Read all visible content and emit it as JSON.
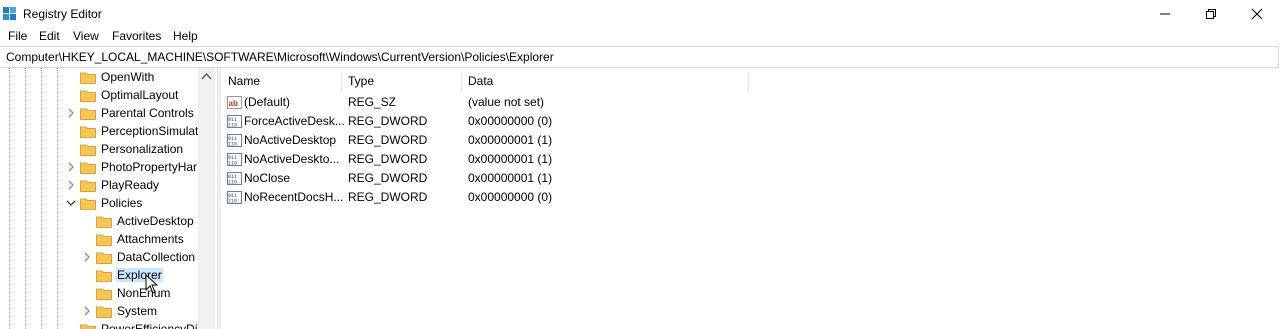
{
  "window": {
    "title": "Registry Editor"
  },
  "menu": [
    "File",
    "Edit",
    "View",
    "Favorites",
    "Help"
  ],
  "address": "Computer\\HKEY_LOCAL_MACHINE\\SOFTWARE\\Microsoft\\Windows\\CurrentVersion\\Policies\\Explorer",
  "tree": [
    {
      "label": "OpenWith",
      "expandable": false,
      "level": 0
    },
    {
      "label": "OptimalLayout",
      "expandable": false,
      "level": 0
    },
    {
      "label": "Parental Controls",
      "expandable": true,
      "level": 0
    },
    {
      "label": "PerceptionSimulat",
      "expandable": false,
      "level": 0
    },
    {
      "label": "Personalization",
      "expandable": false,
      "level": 0
    },
    {
      "label": "PhotoPropertyHar",
      "expandable": true,
      "level": 0
    },
    {
      "label": "PlayReady",
      "expandable": true,
      "level": 0
    },
    {
      "label": "Policies",
      "expandable": true,
      "expanded": true,
      "level": 0
    },
    {
      "label": "ActiveDesktop",
      "expandable": false,
      "level": 1
    },
    {
      "label": "Attachments",
      "expandable": false,
      "level": 1
    },
    {
      "label": "DataCollection",
      "expandable": true,
      "level": 1
    },
    {
      "label": "Explorer",
      "expandable": false,
      "level": 1,
      "selected": true
    },
    {
      "label": "NonEnum",
      "expandable": false,
      "level": 1
    },
    {
      "label": "System",
      "expandable": true,
      "level": 1
    },
    {
      "label": "PowerEfficiencyDi",
      "expandable": false,
      "level": 0
    }
  ],
  "columns": {
    "name": "Name",
    "type": "Type",
    "data": "Data"
  },
  "values": [
    {
      "name": "(Default)",
      "type": "REG_SZ",
      "data": "(value not set)",
      "icon": "string-value-icon"
    },
    {
      "name": "ForceActiveDesk...",
      "type": "REG_DWORD",
      "data": "0x00000000 (0)",
      "icon": "dword-value-icon"
    },
    {
      "name": "NoActiveDesktop",
      "type": "REG_DWORD",
      "data": "0x00000001 (1)",
      "icon": "dword-value-icon"
    },
    {
      "name": "NoActiveDeskto...",
      "type": "REG_DWORD",
      "data": "0x00000001 (1)",
      "icon": "dword-value-icon"
    },
    {
      "name": "NoClose",
      "type": "REG_DWORD",
      "data": "0x00000001 (1)",
      "icon": "dword-value-icon"
    },
    {
      "name": "NoRecentDocsH...",
      "type": "REG_DWORD",
      "data": "0x00000000 (0)",
      "icon": "dword-value-icon"
    }
  ],
  "colors": {
    "selection": "#cce8ff",
    "folder": "#f6c651"
  }
}
